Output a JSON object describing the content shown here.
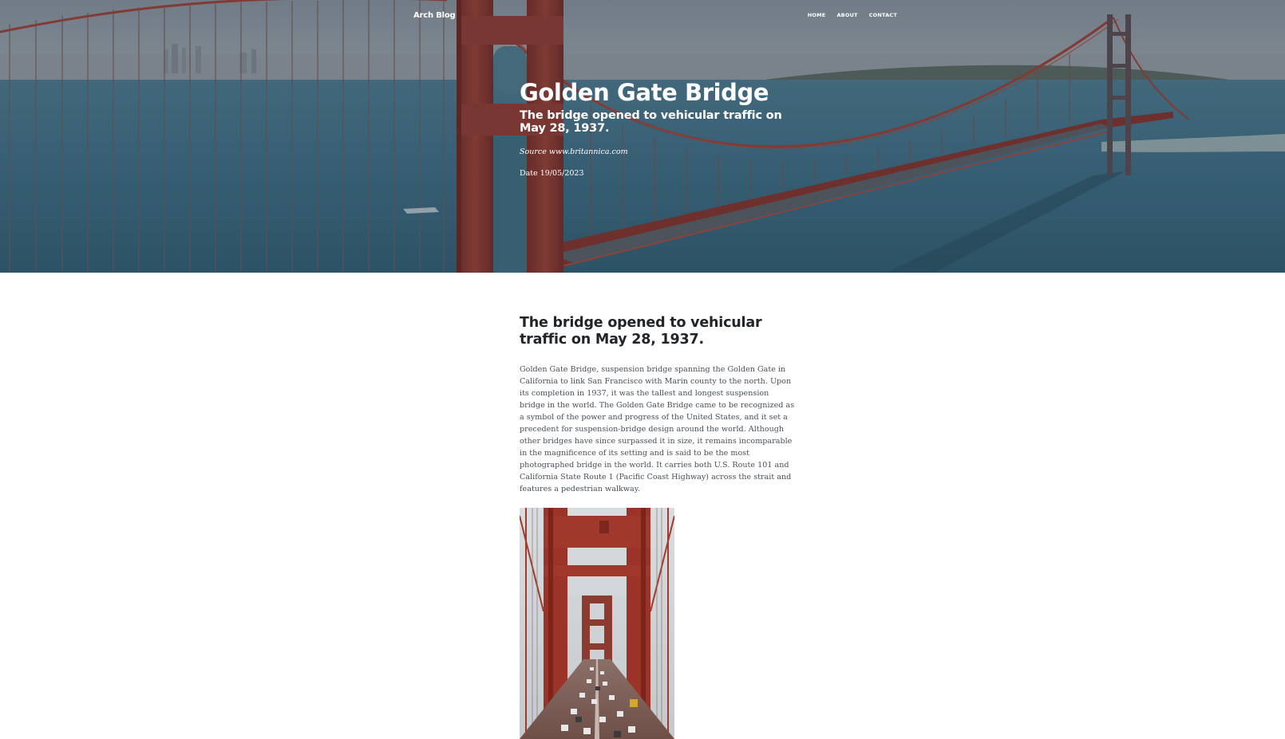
{
  "nav": {
    "brand": "Arch Blog",
    "links": [
      {
        "label": "HOME"
      },
      {
        "label": "ABOUT"
      },
      {
        "label": "CONTACT"
      }
    ]
  },
  "hero": {
    "title": "Golden Gate Bridge",
    "subtitle": "The bridge opened to vehicular traffic on May 28, 1937.",
    "source": "Source www.britannica.com",
    "date": "Date 19/05/2023"
  },
  "article": {
    "heading": "The bridge opened to vehicular traffic on May 28, 1937.",
    "body": "Golden Gate Bridge, suspension bridge spanning the Golden Gate in California to link San Francisco with Marin county to the north. Upon its completion in 1937, it was the tallest and longest suspension bridge in the world. The Golden Gate Bridge came to be recognized as a symbol of the power and progress of the United States, and it set a precedent for suspension-bridge design around the world. Although other bridges have since surpassed it in size, it remains incomparable in the magnificence of its setting and is said to be the most photographed bridge in the world. It carries both U.S. Route 101 and California State Route 1 (Pacific Coast Highway) across the strait and features a pedestrian walkway."
  },
  "colors": {
    "bridge_red": "#9e3a2c",
    "water": "#3b6f86",
    "heading_text": "#212529",
    "body_text": "#495057"
  }
}
